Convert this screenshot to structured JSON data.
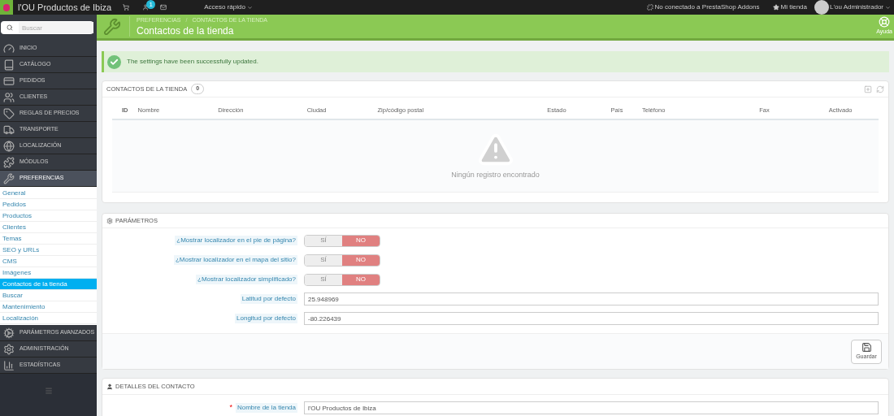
{
  "topbar": {
    "shop_name": "l'OU Productos de Ibiza",
    "notification_count": "1",
    "quick_access": "Acceso rápido",
    "addons": "No conectado a PrestaShop Addons",
    "my_shop": "Mi tienda",
    "user": "L'ou Administrador"
  },
  "sidebar": {
    "search": {
      "placeholder": "Buscar"
    },
    "items": [
      {
        "label": "INICIO",
        "selected": false
      },
      {
        "label": "CATÁLOGO",
        "selected": false
      },
      {
        "label": "PEDIDOS",
        "selected": false
      },
      {
        "label": "CLIENTES",
        "selected": false
      },
      {
        "label": "REGLAS DE PRECIOS",
        "selected": false
      },
      {
        "label": "TRANSPORTE",
        "selected": false
      },
      {
        "label": "LOCALIZACIÓN",
        "selected": false
      },
      {
        "label": "MÓDULOS",
        "selected": false
      },
      {
        "label": "PREFERENCIAS",
        "selected": true,
        "children": [
          {
            "label": "General",
            "selected": false
          },
          {
            "label": "Pedidos",
            "selected": false
          },
          {
            "label": "Productos",
            "selected": false
          },
          {
            "label": "Clientes",
            "selected": false
          },
          {
            "label": "Temas",
            "selected": false
          },
          {
            "label": "SEO y URLs",
            "selected": false
          },
          {
            "label": "CMS",
            "selected": false
          },
          {
            "label": "Imágenes",
            "selected": false
          },
          {
            "label": "Contactos de la tienda",
            "selected": true
          },
          {
            "label": "Buscar",
            "selected": false
          },
          {
            "label": "Mantenimiento",
            "selected": false
          },
          {
            "label": "Localización",
            "selected": false
          }
        ]
      },
      {
        "label": "PARÁMETROS AVANZADOS",
        "selected": false
      },
      {
        "label": "ADMINISTRACIÓN",
        "selected": false
      },
      {
        "label": "ESTADÍSTICAS",
        "selected": false
      }
    ]
  },
  "header": {
    "breadcrumb": [
      "PREFERENCIAS",
      "CONTACTOS DE LA TIENDA"
    ],
    "breadcrumb_separator": "/",
    "title": "Contactos de la tienda",
    "help": "Ayuda"
  },
  "alert": {
    "message": "The settings have been successfully updated."
  },
  "contacts_panel": {
    "title": "CONTACTOS DE LA TIENDA",
    "count": "0",
    "table": {
      "columns": [
        "ID",
        "Nombre",
        "Dirección",
        "Ciudad",
        "Zip/código postal",
        "Estado",
        "País",
        "Teléfono",
        "Fax",
        "Activado"
      ]
    },
    "empty_message": "Ningún registro encontrado"
  },
  "parameters_panel": {
    "title": "PARÁMETROS",
    "fields": [
      {
        "kind": "toggle",
        "label": "¿Mostrar localizador en el pie de página?",
        "options": [
          {
            "label": "SÍ",
            "selected": false
          },
          {
            "label": "NO",
            "selected": true
          }
        ]
      },
      {
        "kind": "toggle",
        "label": "¿Mostrar localizador en el mapa del sitio?",
        "options": [
          {
            "label": "SÍ",
            "selected": false
          },
          {
            "label": "NO",
            "selected": true
          }
        ]
      },
      {
        "kind": "toggle",
        "label": "¿Mostrar localizador simplificado?",
        "options": [
          {
            "label": "SÍ",
            "selected": false
          },
          {
            "label": "NO",
            "selected": true
          }
        ]
      },
      {
        "kind": "text",
        "label": "Latitud por defecto",
        "value": "25.948969"
      },
      {
        "kind": "text",
        "label": "Longitud por defecto",
        "value": "-80.226439"
      }
    ],
    "save": "Guardar"
  },
  "details_panel": {
    "title": "DETALLES DEL CONTACTO",
    "fields": [
      {
        "kind": "text",
        "required_mark": "*",
        "label": "Nombre de la tienda",
        "value": "l'OU Productos de Ibiza"
      }
    ]
  }
}
